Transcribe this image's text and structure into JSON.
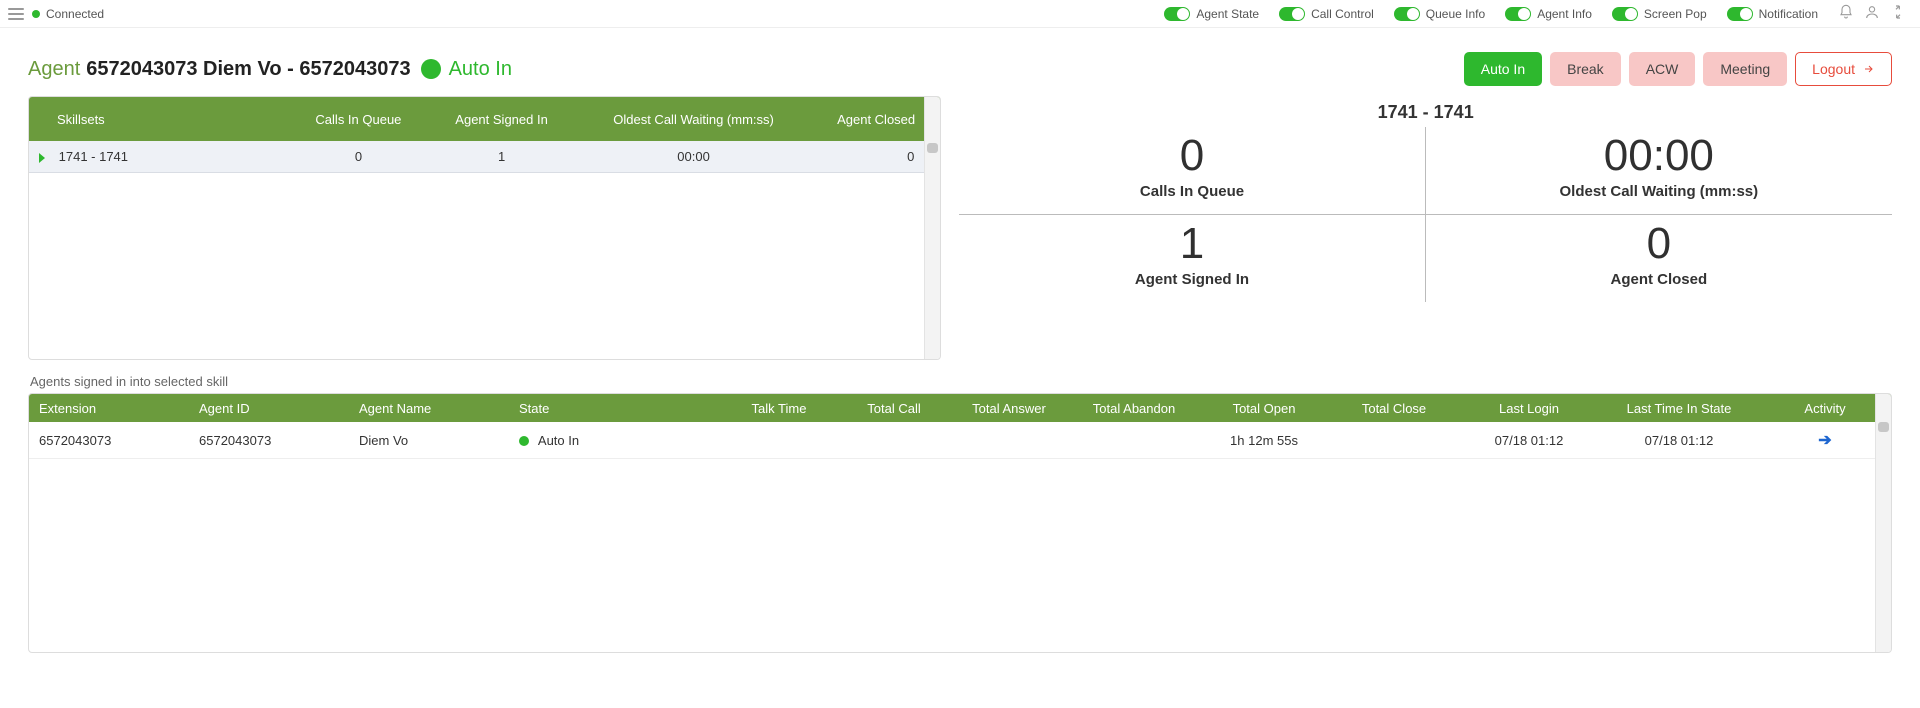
{
  "topbar": {
    "connection": "Connected",
    "toggles": [
      {
        "label": "Agent State"
      },
      {
        "label": "Call Control"
      },
      {
        "label": "Queue Info"
      },
      {
        "label": "Agent Info"
      },
      {
        "label": "Screen Pop"
      },
      {
        "label": "Notification"
      }
    ]
  },
  "header": {
    "agent_label": "Agent",
    "agent_line": "6572043073 Diem Vo - 6572043073",
    "status_text": "Auto In",
    "buttons": {
      "auto_in": "Auto In",
      "break": "Break",
      "acw": "ACW",
      "meeting": "Meeting",
      "logout": "Logout"
    }
  },
  "skill_table": {
    "columns": {
      "skillsets": "Skillsets",
      "calls_in_queue": "Calls In Queue",
      "agent_signed_in": "Agent Signed In",
      "oldest_call": "Oldest Call Waiting (mm:ss)",
      "agent_closed": "Agent Closed"
    },
    "rows": [
      {
        "skillset": "1741 - 1741",
        "calls_in_queue": "0",
        "agent_signed_in": "1",
        "oldest_call": "00:00",
        "agent_closed": "0"
      }
    ]
  },
  "metrics": {
    "title": "1741 - 1741",
    "calls_in_queue": {
      "value": "0",
      "label": "Calls In Queue"
    },
    "oldest_call": {
      "value": "00:00",
      "label": "Oldest Call Waiting  (mm:ss)"
    },
    "agent_signed_in": {
      "value": "1",
      "label": "Agent Signed In"
    },
    "agent_closed": {
      "value": "0",
      "label": "Agent Closed"
    }
  },
  "agents": {
    "caption": "Agents signed in into selected skill",
    "columns": {
      "extension": "Extension",
      "agent_id": "Agent ID",
      "agent_name": "Agent Name",
      "state": "State",
      "talk_time": "Talk Time",
      "total_call": "Total Call",
      "total_answer": "Total Answer",
      "total_abandon": "Total Abandon",
      "total_open": "Total Open",
      "total_close": "Total Close",
      "last_login": "Last Login",
      "last_state": "Last Time In State",
      "activity": "Activity"
    },
    "rows": [
      {
        "extension": "6572043073",
        "agent_id": "6572043073",
        "agent_name": "Diem Vo",
        "state": "Auto In",
        "talk_time": "",
        "total_call": "",
        "total_answer": "",
        "total_abandon": "",
        "total_open": "1h 12m 55s",
        "total_close": "",
        "last_login": "07/18 01:12",
        "last_state": "07/18 01:12"
      }
    ]
  }
}
